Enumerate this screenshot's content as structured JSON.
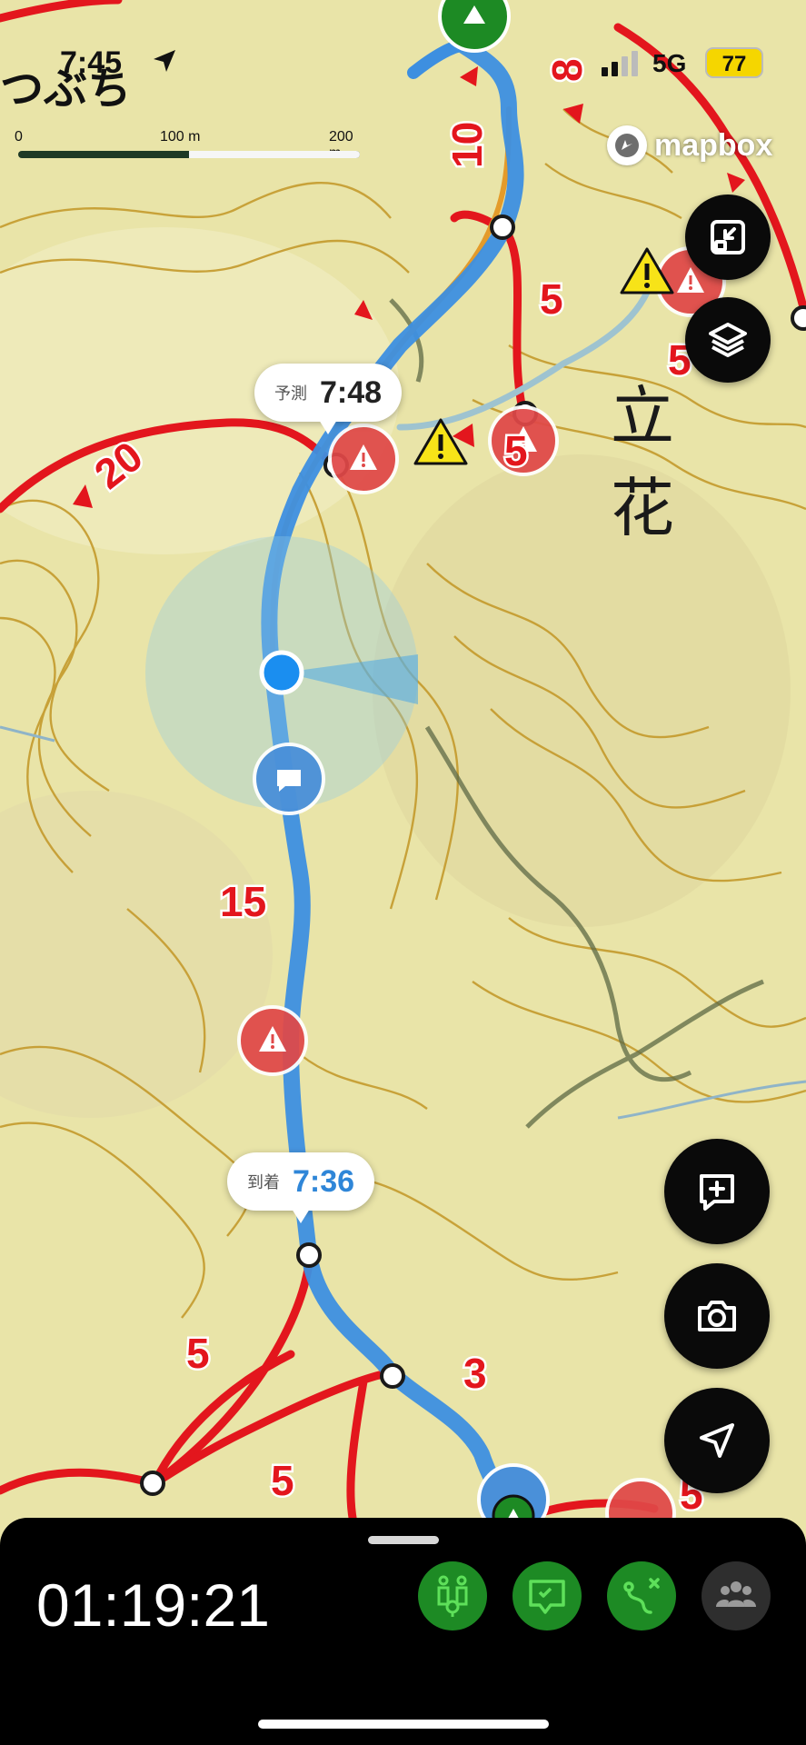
{
  "status_bar": {
    "time": "7:45",
    "network": "5G",
    "battery": "77"
  },
  "map": {
    "place_label_partial": "つぶち",
    "place_label_kanji": "立 花",
    "scale": {
      "labels": [
        "0",
        "100 m",
        "200 m"
      ]
    },
    "attribution": "mapbox",
    "trail_times": [
      "20",
      "15",
      "10",
      "8",
      "5",
      "5",
      "5",
      "5",
      "5",
      "3",
      "5"
    ],
    "callouts": {
      "forecast": {
        "label": "予測",
        "time": "7:48"
      },
      "arrival": {
        "label": "到着",
        "time": "7:36"
      }
    }
  },
  "map_controls": {
    "fullscreen": "fullscreen-icon",
    "layers": "layers-icon",
    "add_note": "add-note-icon",
    "camera": "camera-icon",
    "locate": "location-arrow-icon"
  },
  "bottom_panel": {
    "elapsed_time": "01:19:21",
    "toolbar": [
      "hikers-icon",
      "chat-icon",
      "route-icon",
      "group-icon"
    ]
  },
  "colors": {
    "route": "#3d8fe0",
    "trail": "#e3161d",
    "contour": "#c49a2c",
    "map_bg": "#e9e4a8",
    "toolbar_green": "#1d8a24",
    "toolbar_icon": "#5ee05a"
  }
}
